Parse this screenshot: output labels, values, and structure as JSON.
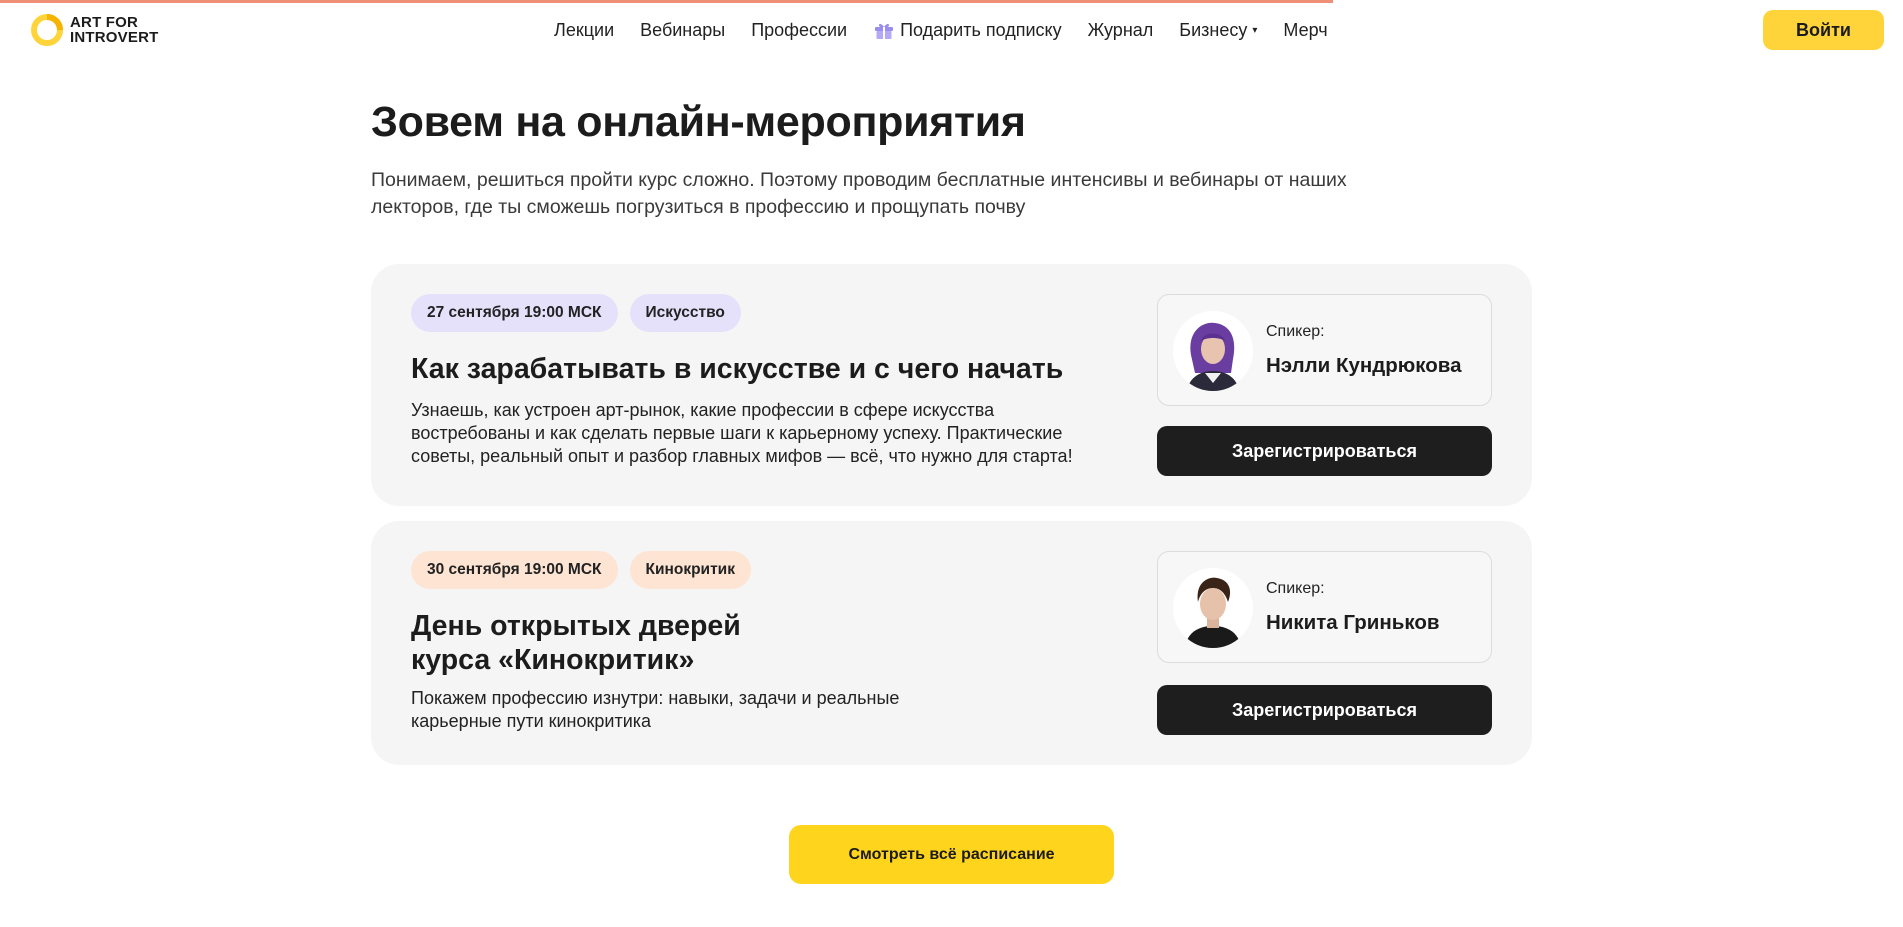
{
  "header": {
    "logo_line1": "ART FOR",
    "logo_line2": "INTROVERT",
    "nav": [
      {
        "label": "Лекции"
      },
      {
        "label": "Вебинары"
      },
      {
        "label": "Профессии"
      },
      {
        "label": "Подарить подписку",
        "icon": "gift-icon"
      },
      {
        "label": "Журнал"
      },
      {
        "label": "Бизнесу",
        "icon": "caret-down-icon"
      },
      {
        "label": "Мерч"
      }
    ],
    "login_label": "Войти"
  },
  "section": {
    "title": "Зовем на онлайн-мероприятия",
    "subtitle": "Понимаем, решиться пройти курс сложно. Поэтому проводим бесплатные интенсивы и вебинары от наших лекторов, где ты сможешь погрузиться в профессию и прощупать почву"
  },
  "events": [
    {
      "date": "27 сентября 19:00 МСК",
      "category": "Искусство",
      "title": "Как зарабатывать в искусстве и с чего начать",
      "description": "Узнаешь, как устроен арт-рынок, какие профессии в сфере искусства востребованы и как сделать первые шаги к карьерному успеху. Практические советы, реальный опыт и разбор главных мифов — всё, что нужно для старта!",
      "speaker_label": "Спикер:",
      "speaker_name": "Нэлли Кундрюкова",
      "register_label": "Зарегистрироваться"
    },
    {
      "date": "30 сентября 19:00 МСК",
      "category": "Кинокритик",
      "title_line1": "День открытых дверей",
      "title_line2": "курса «Кинокритик»",
      "description": "Покажем профессию изнутри: навыки, задачи и реальные карьерные пути кинокритика",
      "speaker_label": "Спикер:",
      "speaker_name": "Никита Гриньков",
      "register_label": "Зарегистрироваться"
    }
  ],
  "schedule_label": "Смотреть всё расписание",
  "colors": {
    "accent_yellow": "#ffd43b",
    "tag_purple": "#e6e1fb",
    "tag_peach": "#fde4d3",
    "card_bg": "#f5f5f5",
    "button_dark": "#1e1e1e"
  }
}
